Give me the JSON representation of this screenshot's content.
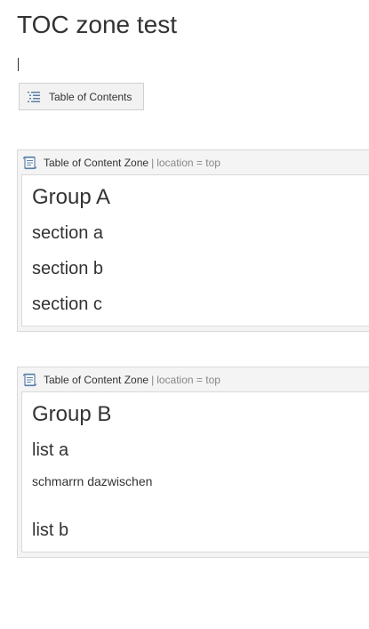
{
  "page": {
    "title": "TOC zone test"
  },
  "toc_button": {
    "icon": "list-icon",
    "label": "Table of Contents"
  },
  "zones": [
    {
      "icon": "scroll-icon",
      "title": "Table of Content Zone",
      "separator": "|",
      "location": "location = top",
      "group_heading": "Group A",
      "sections": [
        "section a",
        "section b",
        "section c"
      ]
    },
    {
      "icon": "scroll-icon",
      "title": "Table of Content Zone",
      "separator": "|",
      "location": "location = top",
      "group_heading": "Group B",
      "list_a": "list a",
      "body_text": "schmarrn dazwischen",
      "list_b": "list b"
    }
  ],
  "colors": {
    "text": "#333333",
    "muted": "#888888",
    "zone_background": "#f4f4f4",
    "border": "#d9d9d9",
    "icon_blue": "#5b7fa8"
  }
}
